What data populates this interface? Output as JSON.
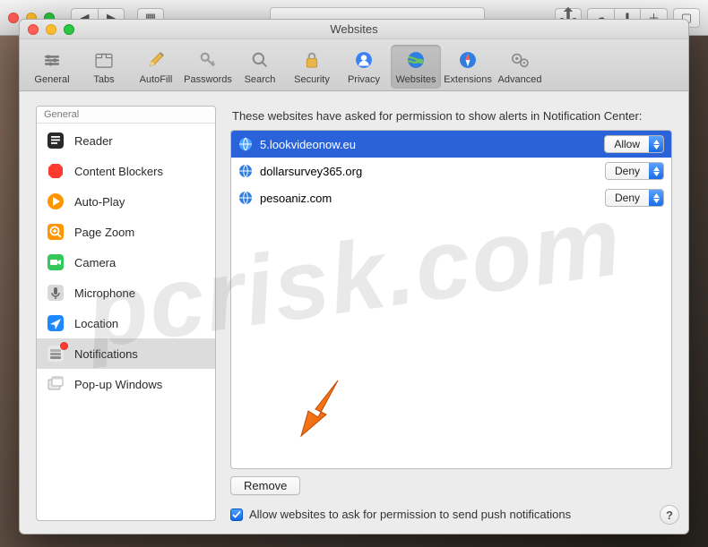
{
  "window_title": "Websites",
  "toolbar": [
    {
      "id": "general",
      "label": "General"
    },
    {
      "id": "tabs",
      "label": "Tabs"
    },
    {
      "id": "autofill",
      "label": "AutoFill"
    },
    {
      "id": "passwords",
      "label": "Passwords"
    },
    {
      "id": "search",
      "label": "Search"
    },
    {
      "id": "security",
      "label": "Security"
    },
    {
      "id": "privacy",
      "label": "Privacy"
    },
    {
      "id": "websites",
      "label": "Websites"
    },
    {
      "id": "extensions",
      "label": "Extensions"
    },
    {
      "id": "advanced",
      "label": "Advanced"
    }
  ],
  "sidebar": {
    "header": "General",
    "items": [
      {
        "id": "reader",
        "label": "Reader"
      },
      {
        "id": "content-blockers",
        "label": "Content Blockers"
      },
      {
        "id": "auto-play",
        "label": "Auto-Play"
      },
      {
        "id": "page-zoom",
        "label": "Page Zoom"
      },
      {
        "id": "camera",
        "label": "Camera"
      },
      {
        "id": "microphone",
        "label": "Microphone"
      },
      {
        "id": "location",
        "label": "Location"
      },
      {
        "id": "notifications",
        "label": "Notifications"
      },
      {
        "id": "popup-windows",
        "label": "Pop-up Windows"
      }
    ]
  },
  "main": {
    "header": "These websites have asked for permission to show alerts in Notification Center:",
    "sites": [
      {
        "domain": "5.lookvideonow.eu",
        "permission": "Allow",
        "selected": true
      },
      {
        "domain": "dollarsurvey365.org",
        "permission": "Deny",
        "selected": false
      },
      {
        "domain": "pesoaniz.com",
        "permission": "Deny",
        "selected": false
      }
    ],
    "remove_label": "Remove",
    "checkbox_label": "Allow websites to ask for permission to send push notifications",
    "checkbox_checked": true
  },
  "help_label": "?",
  "watermark": "pcrisk.com"
}
